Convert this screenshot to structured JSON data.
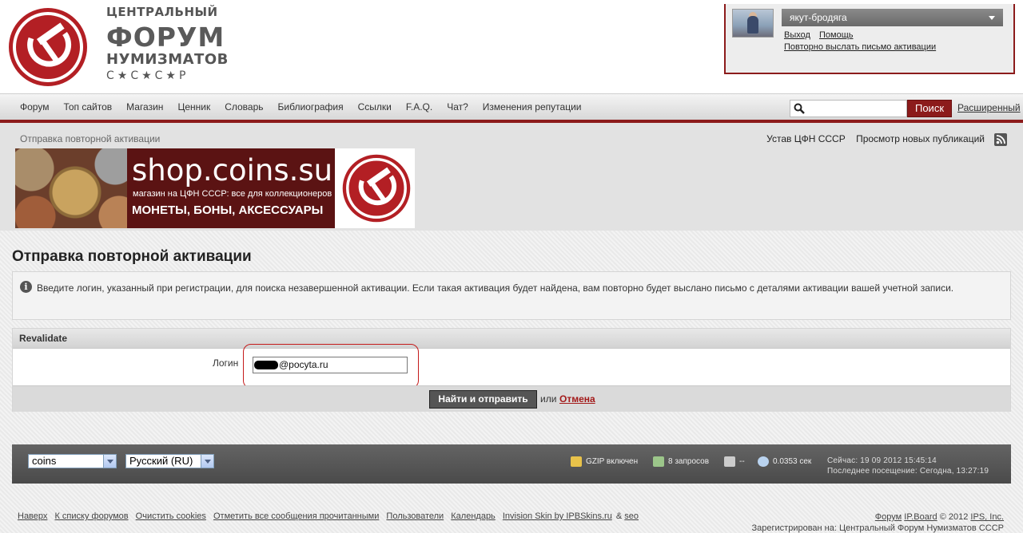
{
  "logo": {
    "line1": "ЦЕНТРАЛЬНЫЙ",
    "line2": "ФОРУМ",
    "line3": "НУМИЗМАТОВ",
    "line4": "С★С★С★Р"
  },
  "user": {
    "name": "якут-бродяга",
    "logout": "Выход",
    "help": "Помощь",
    "resend": "Повторно выслать письмо активации"
  },
  "nav": {
    "items": [
      "Форум",
      "Топ сайтов",
      "Магазин",
      "Ценник",
      "Словарь",
      "Библиография",
      "Ссылки",
      "F.A.Q.",
      "Чат?",
      "Изменения репутации"
    ],
    "search_button": "Поиск",
    "advanced": "Расширенный"
  },
  "breadcrumb": "Отправка повторной активации",
  "sublinks": [
    "Устав ЦФН СССР",
    "Просмотр новых публикаций"
  ],
  "banner": {
    "site": "shop.coins.su",
    "tagline": "магазин на ЦФН СССР: все для коллекционеров",
    "category": "МОНЕТЫ, БОНЫ, АКСЕССУАРЫ"
  },
  "page": {
    "title": "Отправка повторной активации",
    "info": "Введите логин, указанный при регистрации, для поиска незавершенной активации. Если такая активация будет найдена, вам повторно будет выслано письмо с деталями активации вашей учетной записи."
  },
  "form": {
    "header": "Revalidate",
    "login_label": "Логин",
    "login_value": "@pocyta.ru",
    "submit": "Найти и отправить",
    "or": "или",
    "cancel": "Отмена"
  },
  "footer": {
    "skin": "coins",
    "language": "Русский (RU)",
    "gzip": "GZIP включен",
    "queries": "8 запросов",
    "mem": "--",
    "exec": "0.0353 сек",
    "now": "Сейчас: 19 09 2012 15:45:14",
    "last_visit": "Последнее посещение: Сегодна, 13:27:19"
  },
  "bottom": {
    "links": [
      "Наверх",
      "К списку форумов",
      "Очистить cookies",
      "Отметить все сообщения прочитанными",
      "Пользователи",
      "Календарь",
      "Invision Skin by IPBSkins.ru"
    ],
    "amp": "&",
    "seo": "seo",
    "forum": "Форум",
    "ipboard": "IP.Board",
    "copyright": "© 2012",
    "ips": "IPS, Inc.",
    "registered": "Зарегистрирован на: Центральный Форум Нумизматов СССР"
  },
  "colors": {
    "brand": "#8c1b1b",
    "cancel": "#a31a1a"
  }
}
